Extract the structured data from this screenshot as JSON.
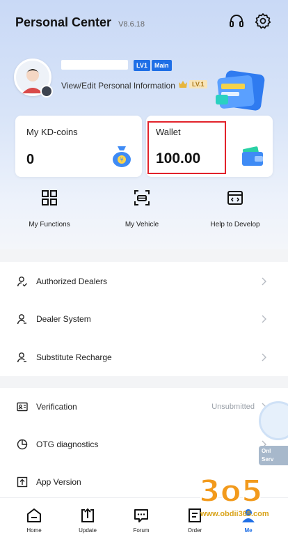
{
  "header": {
    "title": "Personal Center",
    "version": "V8.6.18",
    "support_icon": "headset-icon",
    "settings_icon": "gear-icon"
  },
  "profile": {
    "level_tag": "LV1",
    "role_tag": "Main",
    "edit_link": "View/Edit Personal Information",
    "member_level": "LV.1"
  },
  "cards": {
    "coins": {
      "label": "My KD-coins",
      "value": "0"
    },
    "wallet": {
      "label": "Wallet",
      "value": "100.00"
    }
  },
  "functions": [
    {
      "label": "My Functions",
      "icon": "grid-icon"
    },
    {
      "label": "My Vehicle",
      "icon": "vehicle-scan-icon"
    },
    {
      "label": "Help to Develop",
      "icon": "code-window-icon"
    }
  ],
  "menu_group_1": [
    {
      "label": "Authorized Dealers",
      "icon": "person-check-icon"
    },
    {
      "label": "Dealer System",
      "icon": "person-icon"
    },
    {
      "label": "Substitute Recharge",
      "icon": "person-icon"
    }
  ],
  "menu_group_2": [
    {
      "label": "Verification",
      "icon": "id-card-icon",
      "status": "Unsubmitted"
    },
    {
      "label": "OTG diagnostics",
      "icon": "pie-icon"
    },
    {
      "label": "App Version",
      "icon": "upload-box-icon"
    }
  ],
  "floating_service": {
    "label_line1": "Onl",
    "label_line2": "Serv"
  },
  "watermark": {
    "logo": "3o5",
    "url": "www.obdii365.com"
  },
  "tabbar": [
    {
      "label": "Home",
      "icon": "home-icon"
    },
    {
      "label": "Update",
      "icon": "update-icon"
    },
    {
      "label": "Forum",
      "icon": "chat-icon"
    },
    {
      "label": "Order",
      "icon": "order-icon"
    },
    {
      "label": "Me",
      "icon": "me-icon",
      "active": true
    }
  ],
  "colors": {
    "accent": "#1f6fe6",
    "highlight_box": "#e2222b",
    "hero_bg": "#c9d9f6"
  }
}
